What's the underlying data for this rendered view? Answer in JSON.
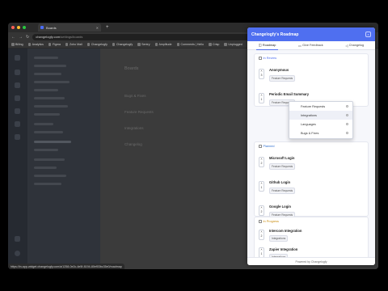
{
  "browser": {
    "tab_title": "Boards",
    "url_host": "changelogfy.com",
    "url_path": "/settings/boards",
    "bookmarks": [
      "Billing",
      "Analytics",
      "Figma",
      "Zoho Mail",
      "Changelogfy",
      "Changelogfy",
      "Sentry",
      "Amplitude",
      "Comments | Hello",
      "Crisp",
      "Unplugged"
    ],
    "status_url": "https://in-app-widget.changelogfy.com/a/1258-0e2c-4e5f-8194-80ef03bc35e0/roadmap"
  },
  "background": {
    "page_title": "Boards",
    "boards": [
      "Bugs & Fixes",
      "Feature Requests",
      "Integrations",
      "Changelog"
    ]
  },
  "panel": {
    "title": "Changelogfy's Roadmap",
    "close_icon": "×",
    "tabs": {
      "roadmap": "Roadmap",
      "give_feedback": "Give Feedback",
      "changelog": "Changelog"
    },
    "sections": {
      "in_review": "In Review",
      "planned": "Planned",
      "in_progress": "In Progress"
    },
    "items": [
      {
        "votes": "3",
        "title": "Anonymous",
        "tag": "Feature Requests"
      },
      {
        "votes": "1",
        "title": "Periodic Email Summary",
        "tag": "Feature Requests"
      },
      {
        "votes": "2",
        "title": "Microsoft Login",
        "tag": "Feature Requests"
      },
      {
        "votes": "1",
        "title": "Github Login",
        "tag": "Feature Requests"
      },
      {
        "votes": "2",
        "title": "Google Login",
        "tag": "Feature Requests"
      },
      {
        "votes": "2",
        "title": "Intercom Integration",
        "tag": "Integrations"
      },
      {
        "votes": "1",
        "title": "Zapier Integration",
        "tag": "Integrations"
      }
    ],
    "dropdown": [
      "Feature Requests",
      "Integrations",
      "Languages",
      "Bugs & Fixes"
    ],
    "footer": "Powered by Changelogfy"
  },
  "colors": {
    "accent": "#4f6ff0"
  }
}
